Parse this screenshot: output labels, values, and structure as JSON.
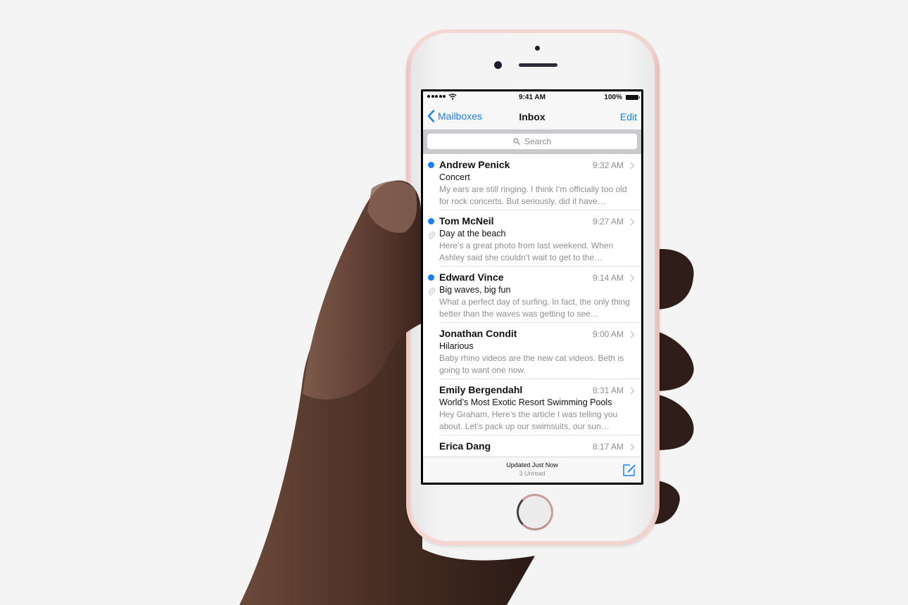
{
  "status_bar": {
    "signal_icon": "signal-dots-icon",
    "wifi_icon": "wifi-icon",
    "time": "9:41 AM",
    "battery_percent": "100%",
    "battery_icon": "battery-full-icon"
  },
  "nav": {
    "back_label": "Mailboxes",
    "back_icon": "chevron-left-icon",
    "title": "Inbox",
    "edit_label": "Edit"
  },
  "search": {
    "placeholder": "Search",
    "icon": "search-icon"
  },
  "messages": [
    {
      "sender": "Andrew Penick",
      "time": "9:32 AM",
      "subject": "Concert",
      "preview": "My ears are still ringing. I think I’m officially too old for rock concerts. But seriously, did it have…",
      "unread": true,
      "attachment": false
    },
    {
      "sender": "Tom McNeil",
      "time": "9:27 AM",
      "subject": "Day at the beach",
      "preview": "Here’s a great photo from last weekend. When Ashley said she couldn’t wait to get to the…",
      "unread": true,
      "attachment": true
    },
    {
      "sender": "Edward Vince",
      "time": "9:14 AM",
      "subject": "Big waves, big fun",
      "preview": "What a perfect day of surfing. In fact, the only thing better than the waves was getting to see…",
      "unread": true,
      "attachment": true
    },
    {
      "sender": "Jonathan Condit",
      "time": "9:00 AM",
      "subject": "Hilarious",
      "preview": "Baby rhino videos are the new cat videos. Beth is going to want one now.",
      "unread": false,
      "attachment": false
    },
    {
      "sender": "Emily Bergendahl",
      "time": "8:31 AM",
      "subject": "World’s Most Exotic Resort Swimming Pools",
      "preview": "Hey Graham, Here’s the article I was telling you about. Let’s pack up our swimsuits, our sun…",
      "unread": false,
      "attachment": false
    },
    {
      "sender": "Erica Dang",
      "time": "8:17 AM",
      "subject": "",
      "preview": "",
      "unread": false,
      "attachment": false
    }
  ],
  "toolbar": {
    "status": "Updated Just Now",
    "unread_count": "3 Unread",
    "compose_icon": "compose-icon"
  },
  "colors": {
    "accent": "#1a7df0",
    "unread_dot": "#1b7cf0",
    "phone_finish": "#f3d2ce",
    "background": "#f4f4f5"
  }
}
